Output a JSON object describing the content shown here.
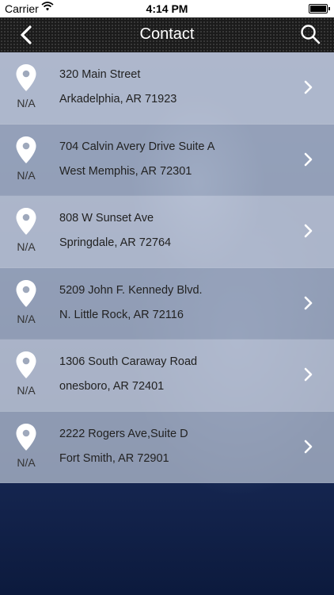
{
  "status_bar": {
    "carrier": "Carrier",
    "time": "4:14 PM"
  },
  "navbar": {
    "title": "Contact"
  },
  "locations": [
    {
      "line1": "320 Main Street",
      "line2": "Arkadelphia, AR 71923",
      "distance": "N/A"
    },
    {
      "line1": "704 Calvin Avery Drive Suite A",
      "line2": "West Memphis, AR 72301",
      "distance": "N/A"
    },
    {
      "line1": "808 W Sunset Ave",
      "line2": "Springdale, AR 72764",
      "distance": "N/A"
    },
    {
      "line1": "5209 John F. Kennedy Blvd.",
      "line2": "N. Little Rock, AR 72116",
      "distance": "N/A"
    },
    {
      "line1": "1306 South Caraway Road",
      "line2": "onesboro, AR 72401",
      "distance": "N/A"
    },
    {
      "line1": "2222 Rogers Ave,Suite D",
      "line2": "Fort Smith, AR 72901",
      "distance": "N/A"
    }
  ]
}
